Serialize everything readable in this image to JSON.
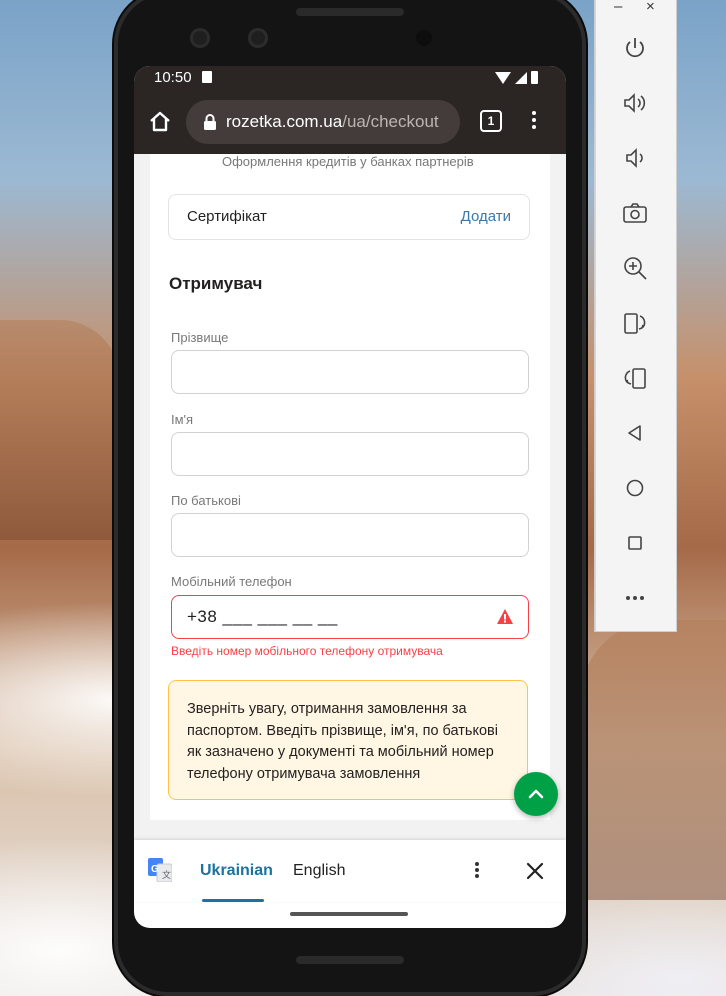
{
  "status": {
    "time": "10:50"
  },
  "browser": {
    "url_host": "rozetka.com.ua",
    "url_path": "/ua/checkout",
    "tab_count": "1"
  },
  "checkout": {
    "credit_note": "Оформлення кредитів у банках партнерів",
    "certificate_label": "Сертифікат",
    "certificate_add": "Додати",
    "recipient_title": "Отримувач",
    "fields": {
      "surname_label": "Прізвище",
      "surname_value": "",
      "name_label": "Ім'я",
      "name_value": "",
      "patronymic_label": "По батькові",
      "patronymic_value": "",
      "phone_label": "Мобільний телефон",
      "phone_value": "+38 ___ ___ __ __"
    },
    "phone_error": "Введіть номер мобільного телефону отримувача",
    "notice": "Зверніть увагу, отримання замовлення за паспортом. Введіть прізвище, ім'я, по батькові як зазначено у документі та мобільний номер телефону отримувача замовлення"
  },
  "translate_bar": {
    "active_language": "Ukrainian",
    "other_language": "English"
  },
  "emulator_panel": {
    "window_controls": [
      "–",
      "×"
    ],
    "buttons": [
      "power-icon",
      "volume-up-icon",
      "volume-down-icon",
      "camera-icon",
      "zoom-icon",
      "rotate-right-icon",
      "rotate-left-icon",
      "back-icon",
      "home-icon",
      "overview-icon",
      "more-icon"
    ]
  },
  "colors": {
    "accent_green": "#00a046",
    "link_blue": "#3e77aa",
    "error_red": "#f84147",
    "notice_bg": "#fff6e3",
    "notice_border": "#ffc34c",
    "toolbar_dark": "#2b2624"
  }
}
